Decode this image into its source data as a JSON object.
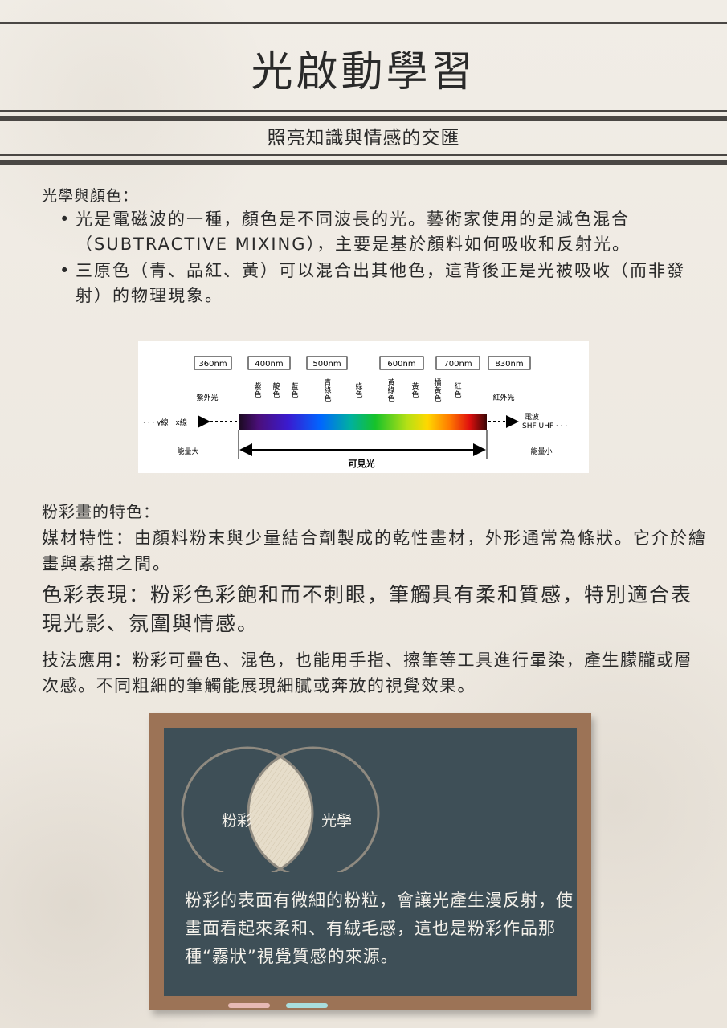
{
  "header": {
    "title": "光啟動學習",
    "subtitle": "照亮知識與情感的交匯"
  },
  "optics": {
    "heading": "光學與顏色：",
    "bullets": [
      "光是電磁波的一種，顏色是不同波長的光。藝術家使用的是減色混合（SUBTRACTIVE MIXING），主要是基於顏料如何吸收和反射光。",
      "三原色（青、品紅、黃）可以混合出其他色，這背後正是光被吸收（而非發射）的物理現象。"
    ]
  },
  "spectrum": {
    "wavelengths": [
      "360nm",
      "400nm",
      "500nm",
      "600nm",
      "700nm",
      "830nm"
    ],
    "colors": [
      "紫色",
      "靛色",
      "藍色",
      "青綠色",
      "綠色",
      "黃綠色",
      "黃色",
      "橘黃色",
      "紅色"
    ],
    "uv_label": "紫外光",
    "ir_label": "紅外光",
    "left_rays": "· · · γ線　x線",
    "right_waves": "電波",
    "right_rays": "SHF UHF · · ·",
    "energy_high": "能量大",
    "energy_low": "能量小",
    "visible_label": "可見光"
  },
  "pastel": {
    "heading": "粉彩畫的特色：",
    "media": "媒材特性：由顏料粉末與少量結合劑製成的乾性畫材，外形通常為條狀。它介於繪畫與素描之間。",
    "color": "色彩表現：粉彩色彩飽和而不刺眼，筆觸具有柔和質感，特別適合表現光影、氛圍與情感。",
    "technique": "技法應用：粉彩可疊色、混色，也能用手指、擦筆等工具進行暈染，產生朦朧或層次感。不同粗細的筆觸能展現細膩或奔放的視覺效果。"
  },
  "chalkboard": {
    "left_circle": "粉彩",
    "right_circle": "光學",
    "text": "粉彩的表面有微細的粉粒，會讓光產生漫反射，使畫面看起來柔和、有絨毛感，這也是粉彩作品那種“霧狀”視覺質感的來源。"
  }
}
